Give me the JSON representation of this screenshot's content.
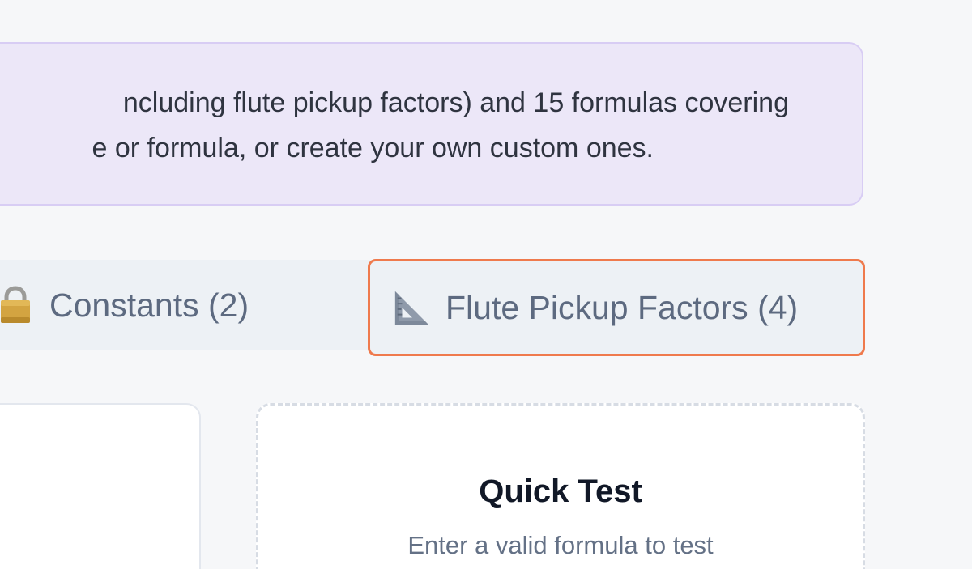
{
  "info_banner": {
    "line1": "ncluding flute pickup factors) and 15 formulas covering",
    "line2": "e or formula, or create your own custom ones."
  },
  "tabs": {
    "constants": {
      "label": "Constants (2)",
      "icon": "lock-icon"
    },
    "flute_pickup_factors": {
      "label": "Flute Pickup Factors (4)",
      "icon": "triangular-ruler-icon",
      "highlight_color": "#ef7a4d"
    }
  },
  "quick_test": {
    "title": "Quick Test",
    "subtitle": "Enter a valid formula to test"
  }
}
